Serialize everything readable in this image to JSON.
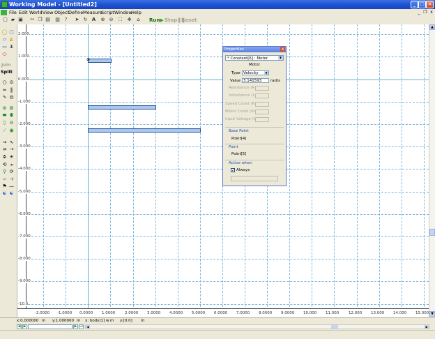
{
  "window": {
    "title": "Working Model - [Untitled2]",
    "minimize": "_",
    "maximize": "□",
    "close": "✕",
    "mdi_minimize": "_",
    "mdi_restore": "❐",
    "mdi_close": "x"
  },
  "menu": [
    "File",
    "Edit",
    "World",
    "View",
    "Object",
    "Define",
    "Measure",
    "Script",
    "Window",
    "Help"
  ],
  "toolbar": {
    "run": "Run",
    "stop": "Stop",
    "reset": "Reset"
  },
  "palette": {
    "join": "Join",
    "split": "Split"
  },
  "canvas": {
    "y_labels": [
      "3.000",
      "2.000",
      "1.000",
      "0.000",
      "-1.000",
      "-2.000",
      "-3.000",
      "-4.000",
      "-5.000",
      "-6.000",
      "-7.000",
      "-8.000",
      "-9.000",
      "-10.0"
    ],
    "x_labels": [
      "-3.0000",
      "-2.0000",
      "-1.0000",
      "0.0000",
      "1.0000",
      "2.0000",
      "3.0000",
      "4.0000",
      "5.0000",
      "6.0000",
      "7.0000",
      "8.0000",
      "9.0000",
      "10.000",
      "11.000",
      "12.000",
      "13.000",
      "14.000",
      "15.000"
    ]
  },
  "coords": {
    "x": "x:0.000000",
    "x_unit": "m",
    "y": "y:1.000000",
    "y_unit": "m",
    "body": "x: body[1] w",
    "body_unit": "m",
    "y2": "y:[0.0]",
    "y2_unit": "m"
  },
  "properties": {
    "title": "Properties",
    "close": "x",
    "object": "* Constant[6] : Motor",
    "header": "Motor",
    "type_label": "Type",
    "type_value": "Velocity",
    "value_label": "Value",
    "value": "3.141593",
    "value_unit": "rad/s",
    "fields": [
      "Resistance (R)",
      "Inductance (L)",
      "Speed Const (Kv)",
      "Motor Const (Km)",
      "Input Voltage (V)"
    ],
    "base_point_label": "Base Point",
    "base_point_value": "Point[4]",
    "point_label": "Point",
    "point_value": "Point[5]",
    "active_when_label": "Active when",
    "always_label": "Always",
    "always_checked": "✓"
  }
}
